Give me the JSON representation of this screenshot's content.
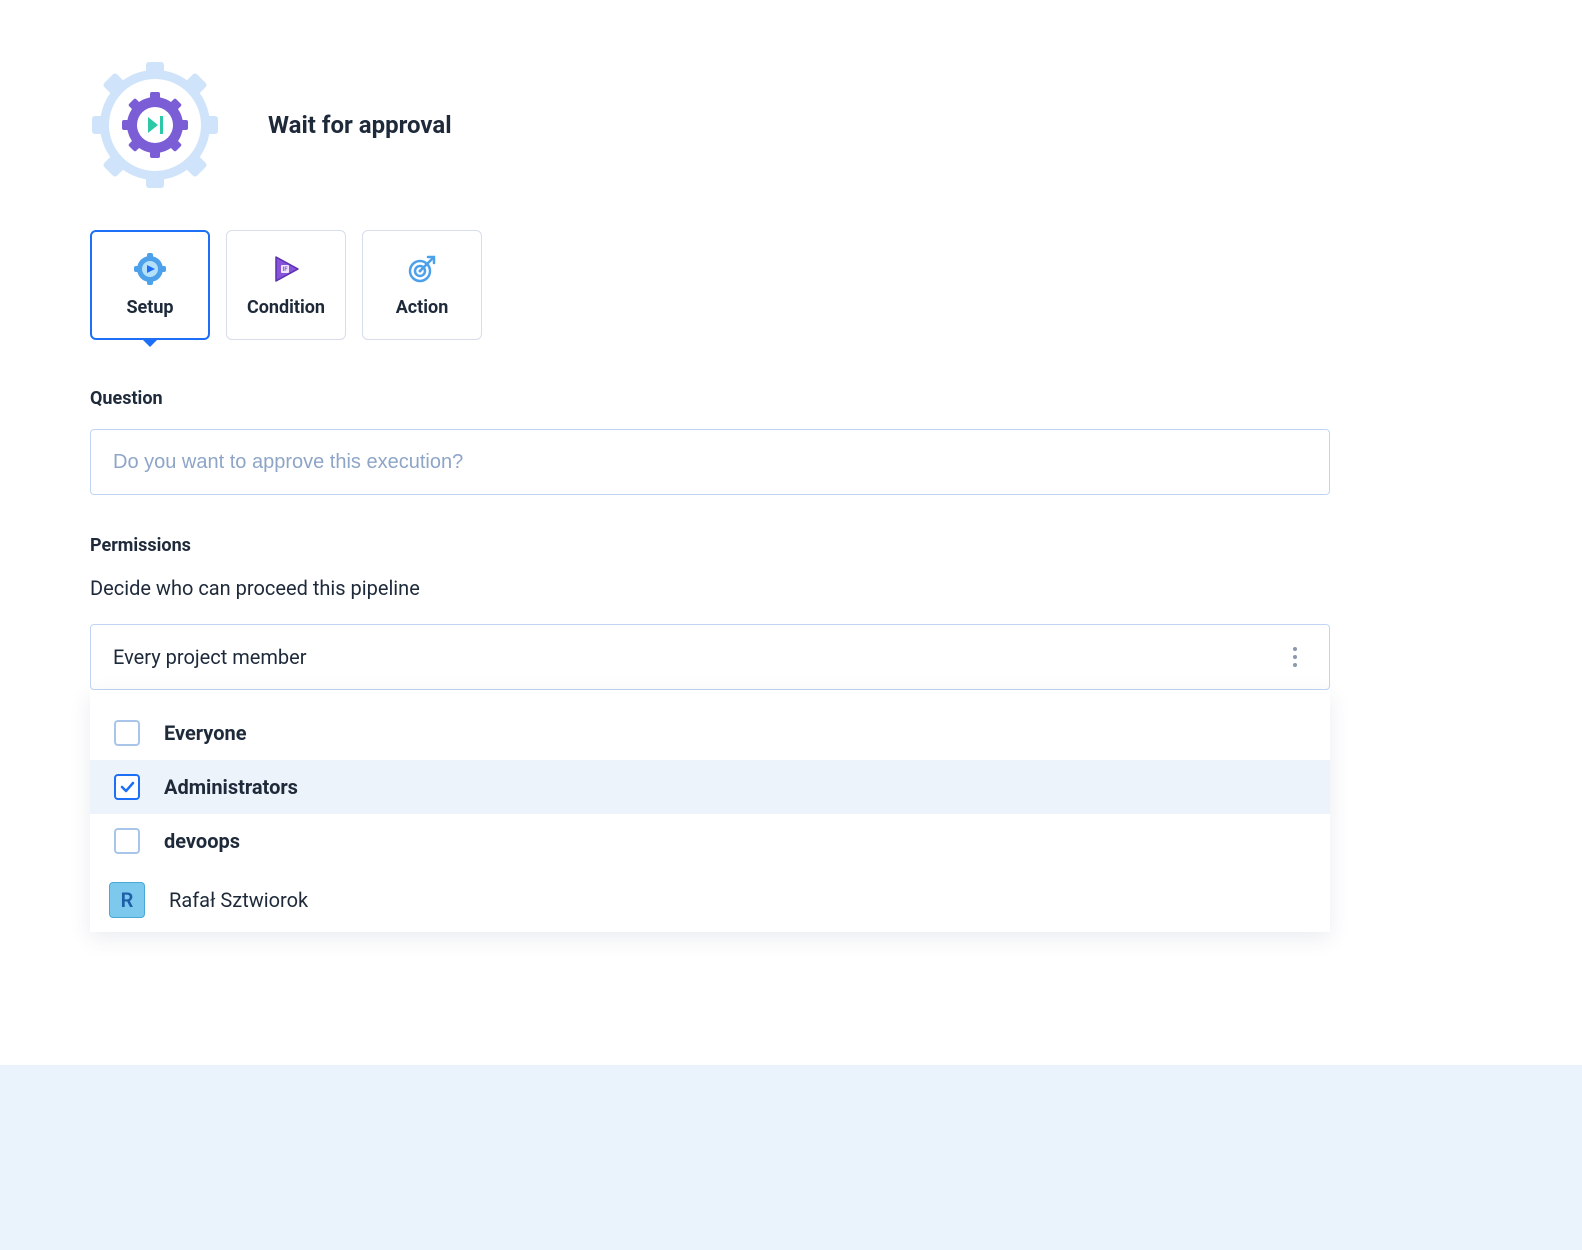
{
  "header": {
    "title": "Wait for approval"
  },
  "tabs": {
    "setup": "Setup",
    "condition": "Condition",
    "action": "Action"
  },
  "question": {
    "label": "Question",
    "placeholder": "Do you want to approve this execution?"
  },
  "permissions": {
    "label": "Permissions",
    "description": "Decide who can proceed this pipeline",
    "selected": "Every project member",
    "options": [
      {
        "label": "Everyone",
        "checked": false,
        "type": "group"
      },
      {
        "label": "Administrators",
        "checked": true,
        "type": "group"
      },
      {
        "label": "devoops",
        "checked": false,
        "type": "group"
      },
      {
        "label": "Rafał Sztwiorok",
        "initial": "R",
        "type": "user"
      }
    ]
  }
}
